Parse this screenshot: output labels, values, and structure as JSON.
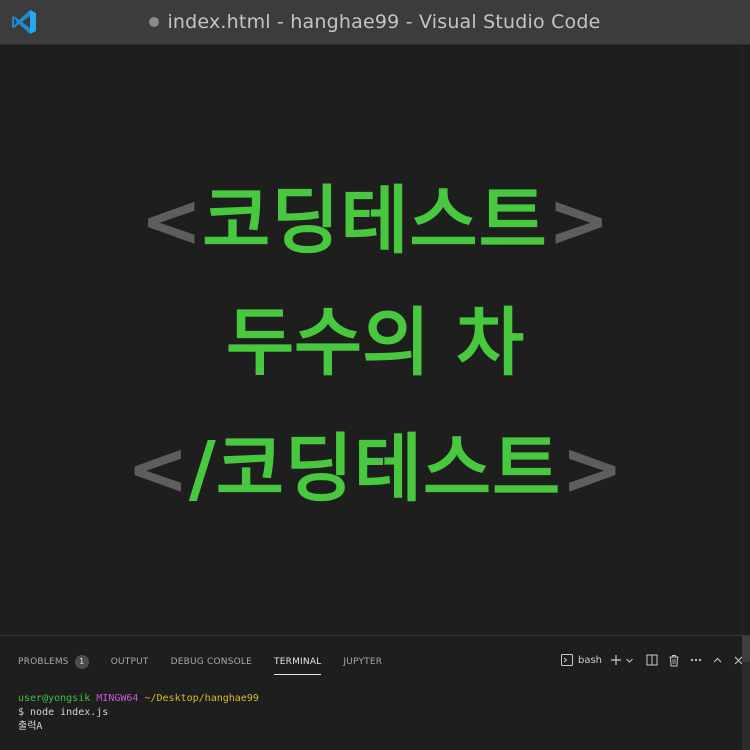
{
  "window": {
    "title": "index.html - hanghae99 - Visual Studio Code"
  },
  "editor": {
    "banner": {
      "open_bracket": "<",
      "open_text": "코딩테스트",
      "close_bracket_end": ">",
      "middle_text": "두수의 차",
      "closing_open": "<",
      "closing_slash": "/",
      "closing_text": "코딩테스트",
      "closing_end": ">"
    }
  },
  "panel": {
    "tabs": [
      {
        "label": "PROBLEMS",
        "badge": "1",
        "active": false
      },
      {
        "label": "OUTPUT",
        "active": false
      },
      {
        "label": "DEBUG CONSOLE",
        "active": false
      },
      {
        "label": "TERMINAL",
        "active": true
      },
      {
        "label": "JUPYTER",
        "active": false
      }
    ],
    "shell_name": "bash",
    "icons": [
      "terminal-icon",
      "plus-icon",
      "chevron-down-icon",
      "split-icon",
      "trash-icon",
      "more-icon",
      "chevron-up-icon",
      "close-icon"
    ]
  },
  "terminal": {
    "user": "user@yongsik",
    "host": "MINGW64",
    "path": "~/Desktop/hanghae99",
    "command": "$ node index.js",
    "output": "출력A"
  },
  "colors": {
    "accent_green": "#47c83e",
    "bracket_gray": "#5e5e5e",
    "logo_blue": "#23a9f2"
  }
}
